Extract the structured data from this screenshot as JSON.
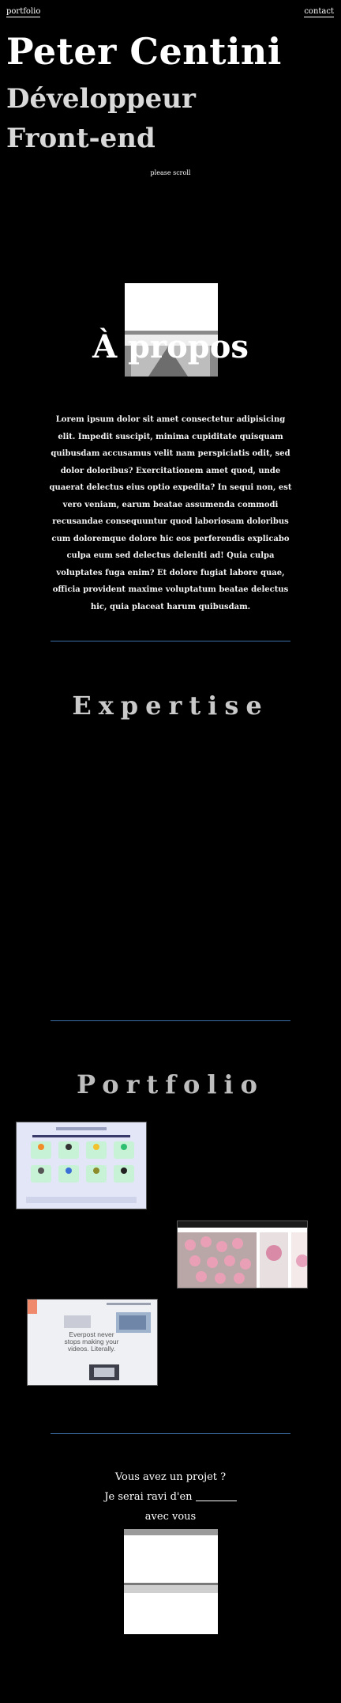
{
  "nav": {
    "brand": "portfolio",
    "contact": "contact"
  },
  "hero": {
    "name": "Peter Centini",
    "role_line1": "Développeur",
    "role_line2": "Front-end",
    "scroll_hint": "please scroll"
  },
  "about": {
    "title": "À propos",
    "text": "Lorem ipsum dolor sit amet consectetur adipisicing elit. Impedit suscipit, minima cupiditate quisquam quibusdam accusamus velit nam perspiciatis odit, sed dolor doloribus? Exercitationem amet quod, unde quaerat delectus eius optio expedita? In sequi non, est vero veniam, earum beatae assumenda commodi recusandae consequuntur quod laboriosam doloribus cum doloremque dolore hic eos perferendis explicabo culpa eum sed delectus deleniti ad! Quia culpa voluptates fuga enim? Et dolore fugiat labore quae, officia provident maxime voluptatum beatae delectus hic, quia placeat harum quibusdam."
  },
  "expertise": {
    "title": "Expertise"
  },
  "portfolio": {
    "title": "Portfolio",
    "project3_caption": "Everpost never stops making your videos. Literally."
  },
  "contact": {
    "line1": "Vous avez un projet ?",
    "line2": "Je serai ravi d'en",
    "line3": "avec vous"
  },
  "colors": {
    "background": "#000000",
    "divider": "#3d6fa8",
    "title_grey": "#c9c9c9"
  }
}
